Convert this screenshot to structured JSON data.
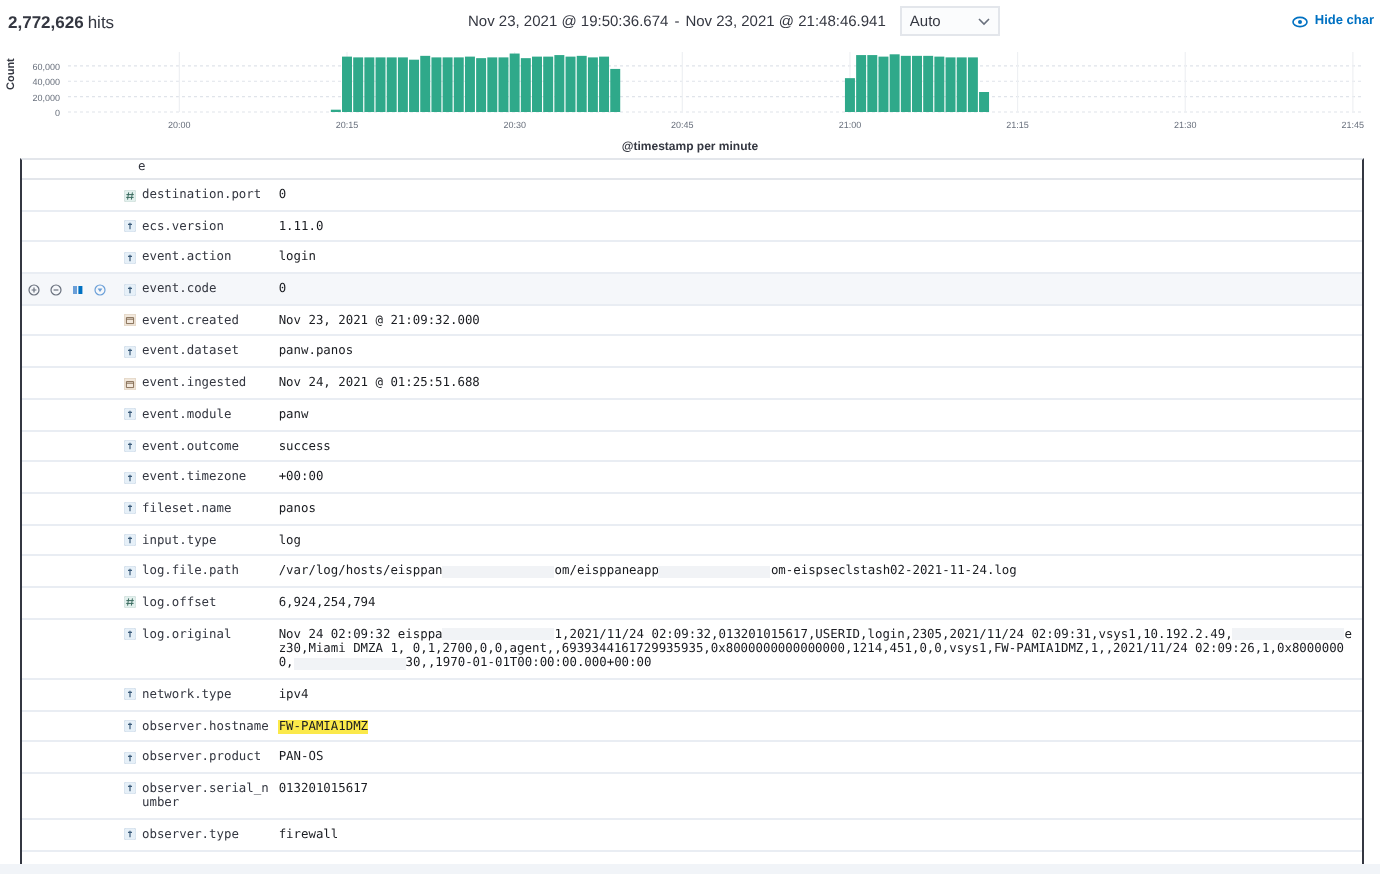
{
  "header": {
    "hits_count": "2,772,626",
    "hits_label": "hits",
    "date_from": "Nov 23, 2021 @ 19:50:36.674",
    "date_separator": "-",
    "date_to": "Nov 23, 2021 @ 21:48:46.941",
    "interval": "Auto",
    "hide_chart": "Hide char"
  },
  "histogram": {
    "chart_data": {
      "type": "bar",
      "grid": true,
      "ylabel": "Count",
      "xlabel": "@timestamp per minute",
      "ylim": [
        0,
        78000
      ],
      "yticks": [
        {
          "value": 0,
          "label": "0"
        },
        {
          "value": 20000,
          "label": "20,000"
        },
        {
          "value": 40000,
          "label": "40,000"
        },
        {
          "value": 60000,
          "label": "60,000"
        }
      ],
      "categories": [
        null,
        null,
        null,
        null,
        null,
        null,
        null,
        null,
        null,
        null,
        "20:00",
        null,
        null,
        null,
        null,
        null,
        null,
        null,
        null,
        null,
        null,
        null,
        null,
        null,
        null,
        "20:15",
        null,
        null,
        null,
        null,
        null,
        null,
        null,
        null,
        null,
        null,
        null,
        null,
        null,
        null,
        "20:30",
        null,
        null,
        null,
        null,
        null,
        null,
        null,
        null,
        null,
        null,
        null,
        null,
        null,
        null,
        "20:45",
        null,
        null,
        null,
        null,
        null,
        null,
        null,
        null,
        null,
        null,
        null,
        null,
        null,
        null,
        "21:00",
        null,
        null,
        null,
        null,
        null,
        null,
        null,
        null,
        null,
        null,
        null,
        null,
        null,
        null,
        "21:15",
        null,
        null,
        null,
        null,
        null,
        null,
        null,
        null,
        null,
        null,
        null,
        null,
        null,
        null,
        "21:30",
        null,
        null,
        null,
        null,
        null,
        null,
        null,
        null,
        null,
        null,
        null,
        null,
        null,
        null,
        "21:45",
        null,
        null,
        null
      ],
      "series": [
        {
          "color": "#2fa98a",
          "values": [
            null,
            null,
            null,
            null,
            null,
            null,
            null,
            null,
            null,
            null,
            null,
            null,
            null,
            null,
            null,
            null,
            null,
            null,
            null,
            null,
            null,
            null,
            null,
            null,
            3000,
            72000,
            71000,
            71000,
            71000,
            71000,
            71000,
            68000,
            73000,
            71000,
            71000,
            71000,
            72000,
            70000,
            71000,
            71000,
            76000,
            70000,
            72000,
            72000,
            74000,
            72000,
            73000,
            71000,
            72000,
            56000,
            null,
            null,
            null,
            null,
            null,
            null,
            null,
            null,
            null,
            null,
            null,
            null,
            null,
            null,
            null,
            null,
            null,
            null,
            null,
            null,
            44000,
            74000,
            74000,
            72000,
            75000,
            73000,
            73000,
            73000,
            72000,
            71000,
            71000,
            71000,
            26000,
            null,
            null,
            null,
            null,
            null,
            null,
            null,
            null,
            null,
            null,
            null,
            null,
            null,
            null,
            null,
            null,
            null,
            null,
            null,
            null,
            null,
            null,
            null,
            null,
            null,
            null,
            null,
            null,
            null,
            null,
            null,
            null,
            null,
            null,
            null,
            null
          ]
        }
      ]
    }
  },
  "doc_rows": [
    {
      "kind": "partial",
      "name": "e"
    },
    {
      "kind": "number",
      "name": "destination.port",
      "value": [
        {
          "kind": "text",
          "text": "0"
        }
      ]
    },
    {
      "kind": "string",
      "name": "ecs.version",
      "value": [
        {
          "kind": "text",
          "text": "1.11.0"
        }
      ]
    },
    {
      "kind": "string",
      "name": "event.action",
      "value": [
        {
          "kind": "text",
          "text": "login"
        }
      ]
    },
    {
      "kind": "string",
      "name": "event.code",
      "hovered": true,
      "value": [
        {
          "kind": "text",
          "text": "0"
        }
      ]
    },
    {
      "kind": "date",
      "name": "event.created",
      "value": [
        {
          "kind": "text",
          "text": "Nov 23, 2021 @ 21:09:32.000"
        }
      ]
    },
    {
      "kind": "string",
      "name": "event.dataset",
      "value": [
        {
          "kind": "text",
          "text": "panw.panos"
        }
      ]
    },
    {
      "kind": "date",
      "name": "event.ingested",
      "value": [
        {
          "kind": "text",
          "text": "Nov 24, 2021 @ 01:25:51.688"
        }
      ]
    },
    {
      "kind": "string",
      "name": "event.module",
      "value": [
        {
          "kind": "text",
          "text": "panw"
        }
      ]
    },
    {
      "kind": "string",
      "name": "event.outcome",
      "value": [
        {
          "kind": "text",
          "text": "success"
        }
      ]
    },
    {
      "kind": "string",
      "name": "event.timezone",
      "value": [
        {
          "kind": "text",
          "text": "+00:00"
        }
      ]
    },
    {
      "kind": "string",
      "name": "fileset.name",
      "value": [
        {
          "kind": "text",
          "text": "panos"
        }
      ]
    },
    {
      "kind": "string",
      "name": "input.type",
      "value": [
        {
          "kind": "text",
          "text": "log"
        }
      ]
    },
    {
      "kind": "string",
      "name": "log.file.path",
      "value": [
        {
          "kind": "text",
          "text": "/var/log/hosts/eisppan"
        },
        {
          "kind": "redacted"
        },
        {
          "kind": "text",
          "text": "om/eisppaneapp"
        },
        {
          "kind": "redacted"
        },
        {
          "kind": "text",
          "text": "om-eispseclstash02-2021-11-24.log"
        }
      ]
    },
    {
      "kind": "number",
      "name": "log.offset",
      "value": [
        {
          "kind": "text",
          "text": "6,924,254,794"
        }
      ]
    },
    {
      "kind": "string",
      "name": "log.original",
      "value": [
        {
          "kind": "text",
          "text": "Nov 24 02:09:32 eisppa"
        },
        {
          "kind": "redacted"
        },
        {
          "kind": "text",
          "text": "1,2021/11/24 02:09:32,013201015617,USERID,login,2305,2021/11/24 02:09:31,vsys1,10.192.2.49,"
        },
        {
          "kind": "redacted"
        },
        {
          "kind": "text",
          "text": "ez30,Miami DMZA 1, 0,1,2700,0,0,agent,,6939344161729935935,0x8000000000000000,1214,451,0,0,vsys1,FW-PAMIA1DMZ,1,,2021/11/24 02:09:26,1,0x80000000,"
        },
        {
          "kind": "redacted"
        },
        {
          "kind": "text",
          "text": "30,,1970-01-01T00:00:00.000+00:00"
        }
      ]
    },
    {
      "kind": "string",
      "name": "network.type",
      "value": [
        {
          "kind": "text",
          "text": "ipv4"
        }
      ]
    },
    {
      "kind": "string",
      "name": "observer.hostname",
      "value": [
        {
          "kind": "text",
          "text": "FW-PAMIA1DMZ",
          "highlighted": true
        }
      ]
    },
    {
      "kind": "string",
      "name": "observer.product",
      "value": [
        {
          "kind": "text",
          "text": "PAN-OS"
        }
      ]
    },
    {
      "kind": "string",
      "name": "observer.serial_number",
      "value": [
        {
          "kind": "text",
          "text": "013201015617"
        }
      ]
    },
    {
      "kind": "string",
      "name": "observer.type",
      "value": [
        {
          "kind": "text",
          "text": "firewall"
        }
      ]
    }
  ]
}
